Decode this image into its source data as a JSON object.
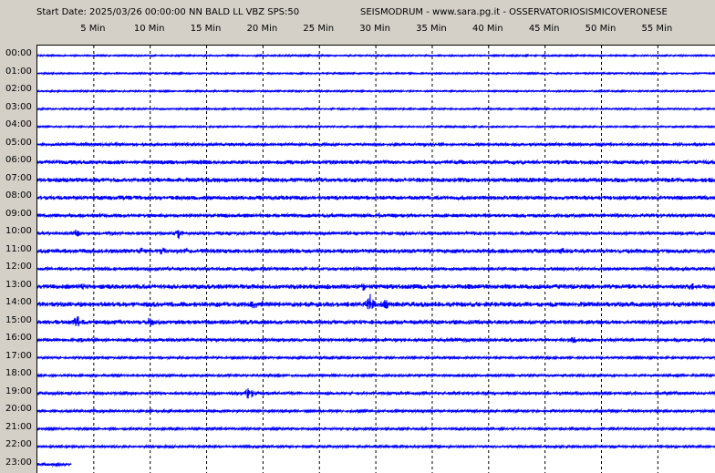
{
  "header": {
    "start_date": "Start Date: 2025/03/26 00:00:00 NN BALD LL VBZ SPS:50",
    "station": "SEISMODRUM - www.sara.pg.it - OSSERVATORIOSISMICOVERONESE"
  },
  "x_ticks": [
    "5 Min",
    "10 Min",
    "15 Min",
    "20 Min",
    "25 Min",
    "30 Min",
    "35 Min",
    "40 Min",
    "45 Min",
    "50 Min",
    "55 Min"
  ],
  "hours": [
    "00:00",
    "01:00",
    "02:00",
    "03:00",
    "04:00",
    "05:00",
    "06:00",
    "07:00",
    "08:00",
    "09:00",
    "10:00",
    "11:00",
    "12:00",
    "13:00",
    "14:00",
    "15:00",
    "16:00",
    "17:00",
    "18:00",
    "19:00",
    "20:00",
    "21:00",
    "22:00",
    "23:00"
  ],
  "trace_color": "#0000ff",
  "grid_color": "#000000",
  "background_color": "#d4d0c8",
  "plot_background": "#ffffff",
  "trace_noise_levels": [
    0.8,
    0.8,
    0.8,
    0.8,
    0.8,
    1.5,
    2.2,
    2.5,
    2.3,
    2.0,
    1.8,
    2.3,
    1.8,
    2.6,
    2.8,
    2.4,
    1.8,
    1.2,
    1.2,
    1.5,
    1.3,
    1.2,
    1.2,
    1.5
  ],
  "last_trace_extent_min": 3,
  "events": [
    {
      "hour": 9,
      "minute": 30.3,
      "amp": 4
    },
    {
      "hour": 10,
      "minute": 12.5,
      "amp": 7
    },
    {
      "hour": 10,
      "minute": 3.5,
      "amp": 5
    },
    {
      "hour": 11,
      "minute": 9.2,
      "amp": 5
    },
    {
      "hour": 11,
      "minute": 11.1,
      "amp": 6
    },
    {
      "hour": 11,
      "minute": 13.3,
      "amp": 5
    },
    {
      "hour": 11,
      "minute": 46.5,
      "amp": 4
    },
    {
      "hour": 13,
      "minute": 4.0,
      "amp": 4
    },
    {
      "hour": 13,
      "minute": 28.9,
      "amp": 5
    },
    {
      "hour": 13,
      "minute": 58.0,
      "amp": 7
    },
    {
      "hour": 14,
      "minute": 19.2,
      "amp": 6
    },
    {
      "hour": 14,
      "minute": 20.0,
      "amp": 5
    },
    {
      "hour": 14,
      "minute": 29.5,
      "amp": 12
    },
    {
      "hour": 14,
      "minute": 30.8,
      "amp": 7
    },
    {
      "hour": 14,
      "minute": 54.8,
      "amp": 5
    },
    {
      "hour": 15,
      "minute": 3.5,
      "amp": 8
    },
    {
      "hour": 15,
      "minute": 10.0,
      "amp": 6
    },
    {
      "hour": 16,
      "minute": 3.8,
      "amp": 4
    },
    {
      "hour": 16,
      "minute": 47.5,
      "amp": 4
    },
    {
      "hour": 19,
      "minute": 18.8,
      "amp": 8
    }
  ]
}
